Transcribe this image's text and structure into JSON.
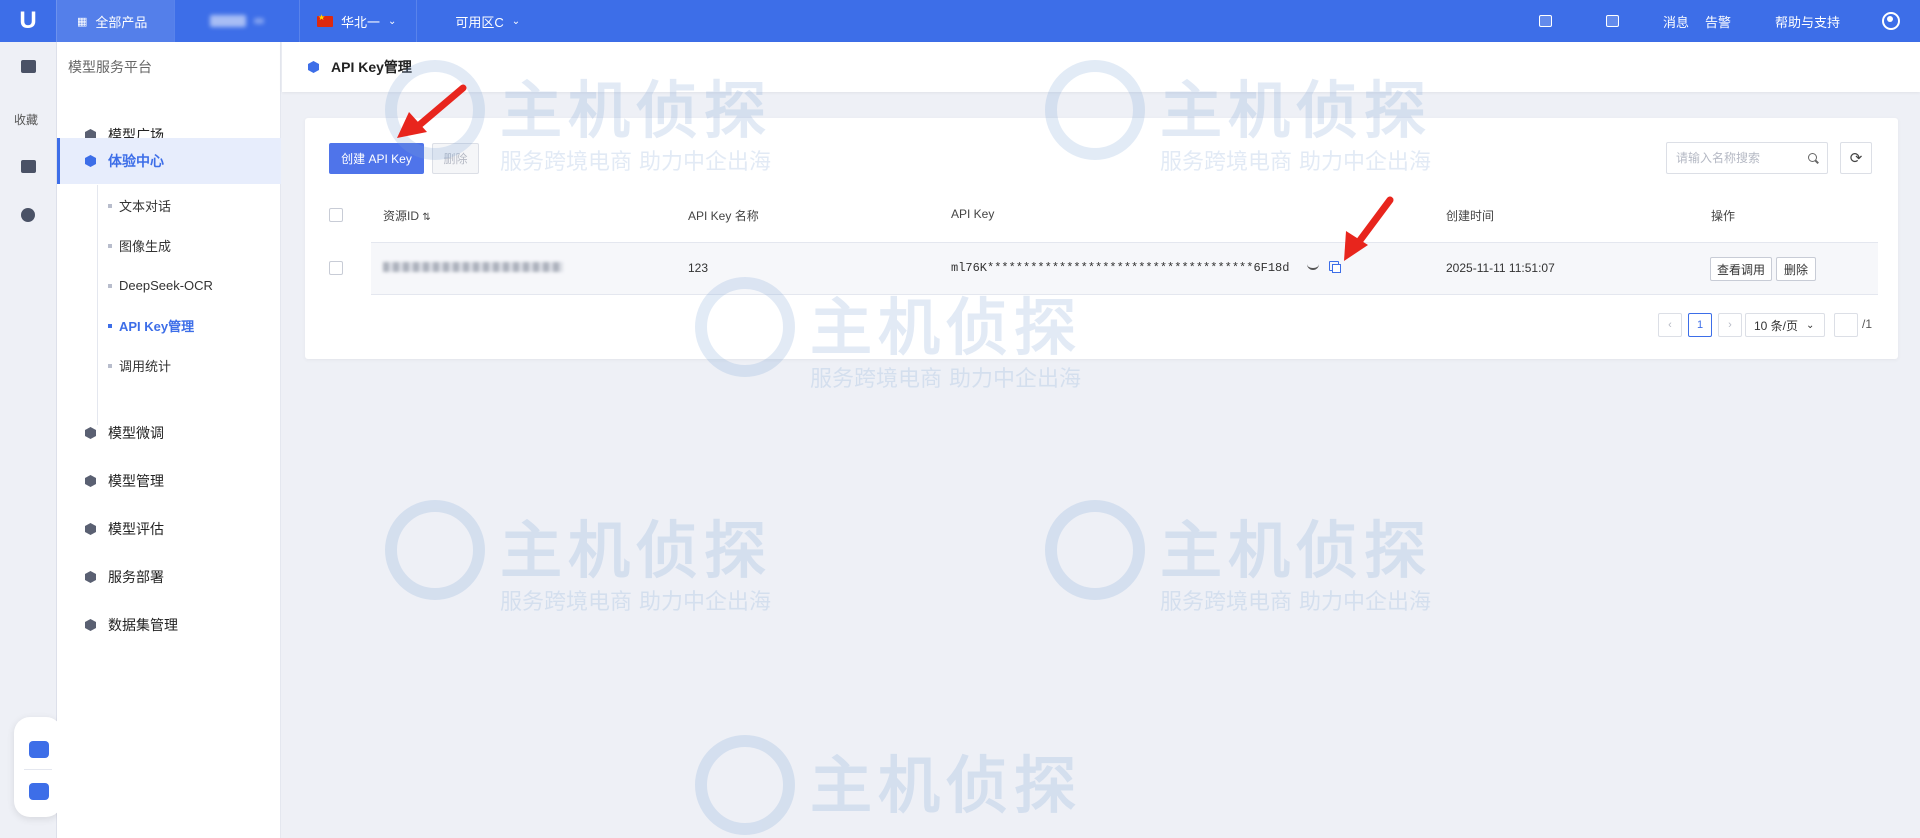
{
  "topbar": {
    "logo": "U",
    "all_products": "全部产品",
    "region": "华北一",
    "zone": "可用区C",
    "messages": "消息",
    "alerts": "告警",
    "help": "帮助与支持"
  },
  "rail": {
    "favorites": "收藏"
  },
  "sidebar": {
    "title": "模型服务平台",
    "items": [
      {
        "label": "模型广场"
      },
      {
        "label": "体验中心"
      },
      {
        "label": "模型微调"
      },
      {
        "label": "模型管理"
      },
      {
        "label": "模型评估"
      },
      {
        "label": "服务部署"
      },
      {
        "label": "数据集管理"
      }
    ],
    "subitems": [
      {
        "label": "文本对话"
      },
      {
        "label": "图像生成"
      },
      {
        "label": "DeepSeek-OCR"
      },
      {
        "label": "API Key管理"
      },
      {
        "label": "调用统计"
      }
    ]
  },
  "page": {
    "title": "API Key管理"
  },
  "toolbar": {
    "create_label": "创建 API Key",
    "delete_label": "删除",
    "search_placeholder": "请输入名称搜索"
  },
  "table": {
    "columns": [
      "资源ID",
      "API Key 名称",
      "API Key",
      "创建时间",
      "操作"
    ],
    "rows": [
      {
        "name": "123",
        "api_key": "ml76K*************************************6F18d",
        "created": "2025-11-11 11:51:07",
        "view_label": "查看调用",
        "delete_label": "删除"
      }
    ]
  },
  "pagination": {
    "prev": "‹",
    "current": "1",
    "next": "›",
    "page_size": "10 条/页",
    "total": "/1"
  },
  "watermark": {
    "title": "主机侦探",
    "subtitle": "服务跨境电商 助力中企出海"
  },
  "colors": {
    "primary": "#3d6ee8",
    "arrow": "#e8251d"
  }
}
